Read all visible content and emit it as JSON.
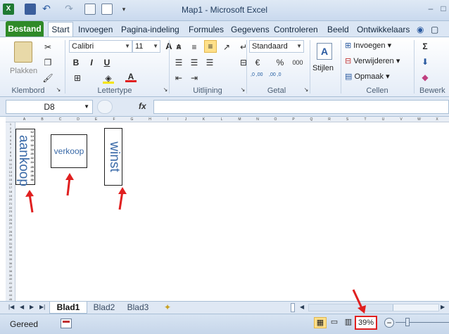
{
  "window": {
    "title": "Map1 - Microsoft Excel",
    "min": "–",
    "max": "□",
    "close": "×"
  },
  "tabs": [
    "Bestand",
    "Start",
    "Invoegen",
    "Pagina-indeling",
    "Formules",
    "Gegevens",
    "Controleren",
    "Beeld",
    "Ontwikkelaars"
  ],
  "ribbon": {
    "groups": {
      "klembord": "Klembord",
      "lettertype": "Lettertype",
      "uitlijning": "Uitlijning",
      "getal": "Getal",
      "cellen": "Cellen",
      "bewerken": "Bewerk"
    },
    "paste_label": "Plakken",
    "font_name": "Calibri",
    "font_size": "11",
    "number_format": "Standaard",
    "styles_label": "Stijlen",
    "insert_label": "Invoegen",
    "delete_label": "Verwijderen",
    "format_label": "Opmaak",
    "percent": "%",
    "thousands": "000",
    "inc_decimals": ",0 ,00",
    "dec_decimals": ",00 ,0",
    "currency": "€",
    "bold": "B",
    "italic": "I",
    "underline": "U",
    "font_color_a": "A",
    "sum": "Σ",
    "grow_font": "A",
    "shrink_font": "A"
  },
  "formula_bar": {
    "name_box": "D8",
    "fx": "fx",
    "value": ""
  },
  "columns": [
    "A",
    "B",
    "C",
    "D",
    "E",
    "F",
    "G",
    "H",
    "I",
    "J",
    "K",
    "L",
    "M",
    "N",
    "O",
    "P",
    "Q",
    "R",
    "S",
    "T",
    "U",
    "V",
    "W",
    "X"
  ],
  "rows": [
    "1",
    "2",
    "3",
    "4",
    "5",
    "6",
    "7",
    "8",
    "9",
    "10",
    "11",
    "12",
    "13",
    "14",
    "15",
    "16",
    "17",
    "18",
    "19",
    "20",
    "21",
    "22",
    "23",
    "24",
    "25",
    "26",
    "27",
    "28",
    "29",
    "30",
    "31",
    "32",
    "33",
    "34",
    "35",
    "36",
    "37",
    "38",
    "39",
    "40",
    "41",
    "42",
    "43",
    "44",
    "45"
  ],
  "shapes": {
    "aankoop": "aankoop",
    "verkoop": "verkoop",
    "winst": "winst"
  },
  "small_numbers": [
    "12",
    "14",
    "15",
    "16",
    "18",
    "20",
    "22",
    "24",
    "25",
    "26",
    "28",
    "30"
  ],
  "sheets": [
    "Blad1",
    "Blad2",
    "Blad3"
  ],
  "status": {
    "ready": "Gereed",
    "zoom": "39%"
  },
  "colors": {
    "file_tab": "#2f8a28",
    "accent_text": "#3a6aa8",
    "highlight": "#e02020"
  }
}
